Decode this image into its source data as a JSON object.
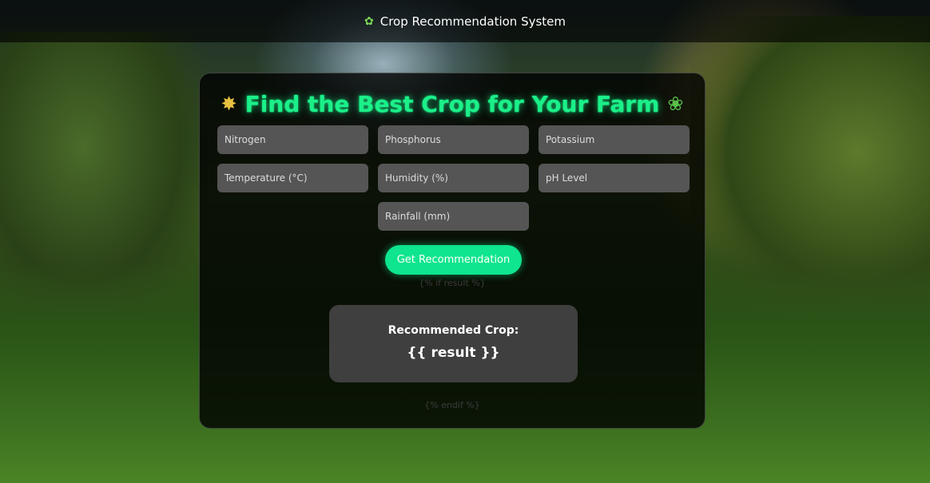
{
  "header": {
    "icon": "herb-icon",
    "title": "Crop Recommendation System"
  },
  "form": {
    "heading": "Find the Best Crop for Your Farm",
    "heading_icons": [
      "corn-icon",
      "seedling-icon"
    ],
    "fields": [
      {
        "placeholder": "Nitrogen"
      },
      {
        "placeholder": "Phosphorus"
      },
      {
        "placeholder": "Potassium"
      },
      {
        "placeholder": "Temperature (°C)"
      },
      {
        "placeholder": "Humidity (%)"
      },
      {
        "placeholder": "pH Level"
      },
      {
        "placeholder": "Rainfall (mm)"
      }
    ],
    "submit_label": "Get Recommendation"
  },
  "template_tags": {
    "if_result": "{% if result %}",
    "endif": "{% endif %}"
  },
  "result": {
    "label": "Recommended Crop:",
    "value": "{{ result }}"
  },
  "colors": {
    "accent": "#0ee58e",
    "heading": "#1bf089",
    "input_bg": "#555555"
  }
}
